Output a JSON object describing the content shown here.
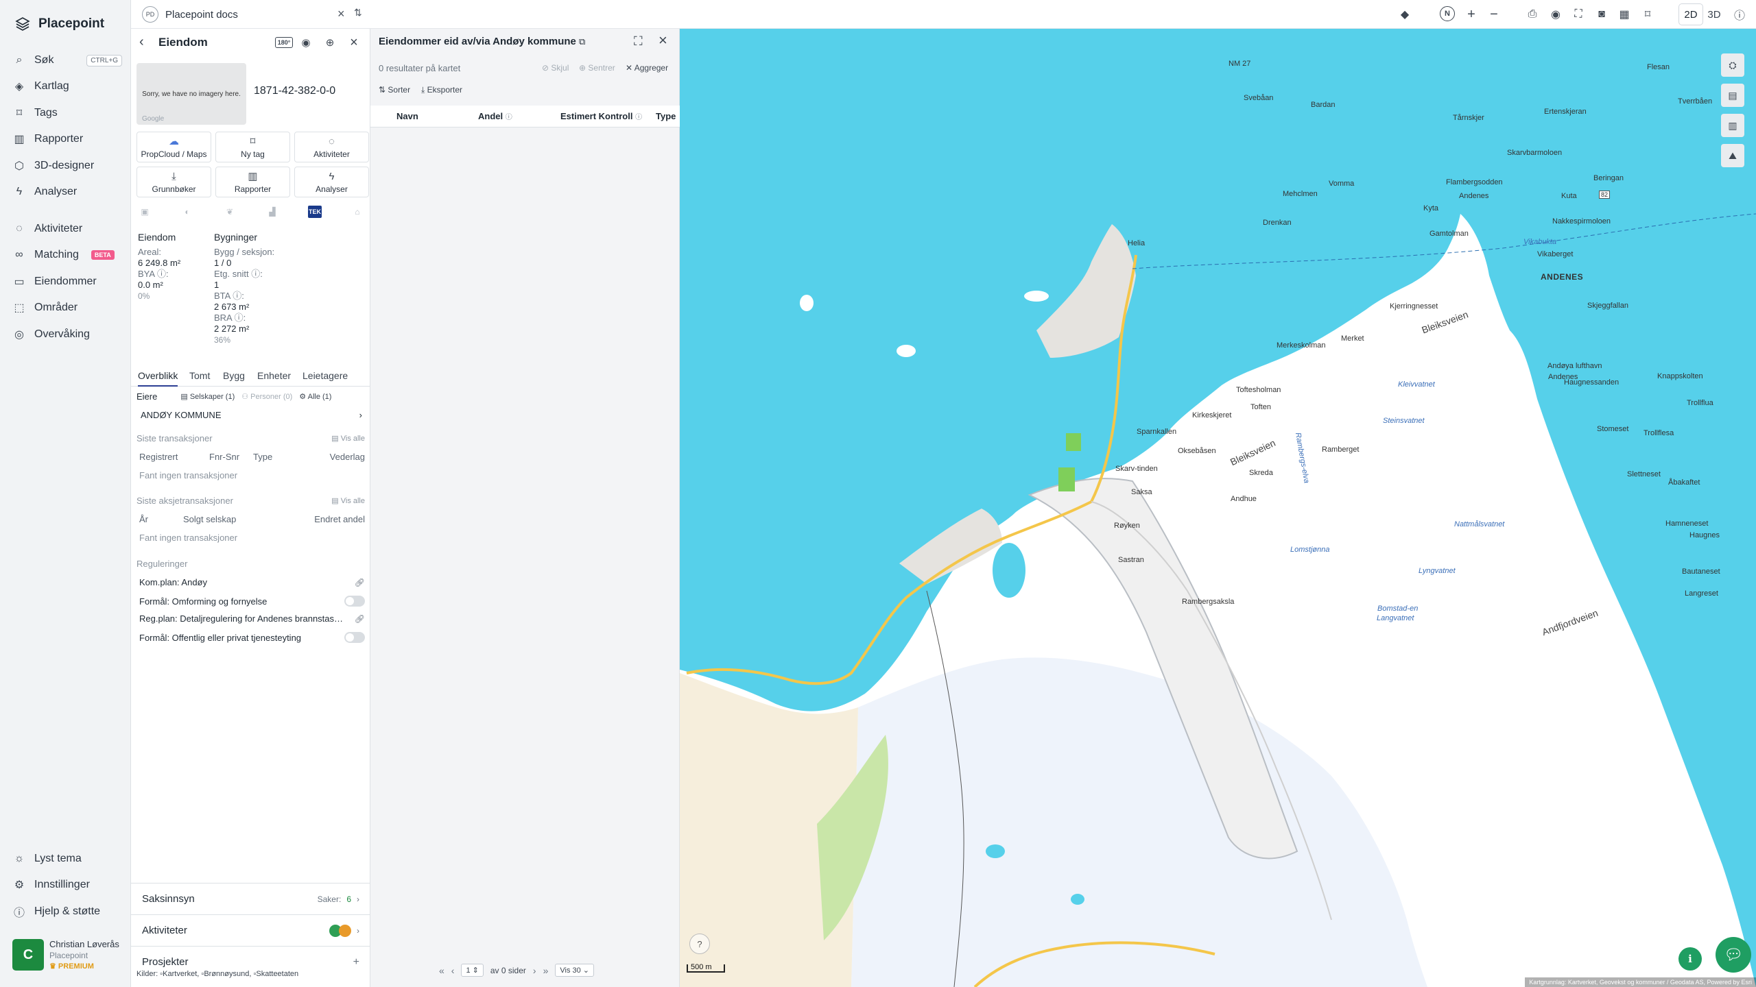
{
  "nav": {
    "brand": "Placepoint",
    "items": [
      {
        "label": "Søk",
        "kbd": "CTRL+G"
      },
      {
        "label": "Kartlag"
      },
      {
        "label": "Tags"
      },
      {
        "label": "Rapporter"
      },
      {
        "label": "3D-designer"
      },
      {
        "label": "Analyser"
      },
      {
        "label": "Aktiviteter"
      },
      {
        "label": "Matching",
        "badge": "BETA"
      },
      {
        "label": "Eiendommer"
      },
      {
        "label": "Områder"
      },
      {
        "label": "Overvåking"
      }
    ],
    "bottom": [
      {
        "label": "Lyst tema"
      },
      {
        "label": "Innstillinger"
      },
      {
        "label": "Hjelp & støtte"
      }
    ],
    "user": {
      "initial": "C",
      "name": "Christian Løverås",
      "org": "Placepoint",
      "plan": "PREMIUM"
    }
  },
  "topbar": {
    "doc_badge": "PD",
    "doc_title": "Placepoint docs",
    "mode_2d": "2D",
    "mode_3d": "3D",
    "north": "N"
  },
  "property": {
    "title": "Eiendom",
    "badge": "180°",
    "imagery_text": "Sorry, we have no imagery here.",
    "imagery_brand": "Google",
    "id": "1871-42-382-0-0",
    "actions": [
      {
        "label": "PropCloud / Maps"
      },
      {
        "label": "Ny tag"
      },
      {
        "label": "Aktiviteter"
      },
      {
        "label": "Grunnbøker"
      },
      {
        "label": "Rapporter"
      },
      {
        "label": "Analyser"
      }
    ],
    "source_tek": "TEK",
    "facts": {
      "eiendom_head": "Eiendom",
      "areal_label": "Areal:",
      "areal_value": "6 249.8 m²",
      "bya_label": "BYA ⓘ:",
      "bya_value": "0.0 m²",
      "bya_pct": "0%",
      "bygninger_head": "Bygninger",
      "bygg_label": "Bygg / seksjon:",
      "bygg_value": "1 / 0",
      "etg_label": "Etg. snitt ⓘ:",
      "etg_value": "1",
      "bta_label": "BTA ⓘ:",
      "bta_value": "2 673 m²",
      "bra_label": "BRA ⓘ:",
      "bra_value": "2 272 m²",
      "bra_pct": "36%"
    },
    "tabs": [
      "Overblikk",
      "Tomt",
      "Bygg",
      "Enheter",
      "Leietagere"
    ],
    "owners": {
      "label": "Eiere",
      "selskaper": "Selskaper (1)",
      "personer": "Personer (0)",
      "alle": "Alle (1)",
      "owner_name": "ANDØY KOMMUNE"
    },
    "transactions": {
      "title": "Siste transaksjoner",
      "vis_alle": "Vis alle",
      "cols": [
        "Registrert",
        "Fnr-Snr",
        "Type",
        "Vederlag"
      ],
      "empty": "Fant ingen transaksjoner"
    },
    "share_transactions": {
      "title": "Siste aksjetransaksjoner",
      "vis_alle": "Vis alle",
      "cols": [
        "År",
        "Solgt selskap",
        "Endret andel"
      ],
      "empty": "Fant ingen transaksjoner"
    },
    "regulations": {
      "title": "Reguleringer",
      "items": [
        "Kom.plan: Andøy",
        "Formål: Omforming og fornyelse",
        "Reg.plan: Detaljregulering for Andenes brannstas…",
        "Formål: Offentlig eller privat tjenesteyting"
      ]
    },
    "saksinnsyn": {
      "label": "Saksinnsyn",
      "count_label": "Saker:",
      "count": "6"
    },
    "aktiviteter": {
      "label": "Aktiviteter"
    },
    "prosjekter": {
      "label": "Prosjekter",
      "add": "+"
    },
    "sources_label": "Kilder:",
    "sources": [
      "Kartverket,",
      "Brønnøysund,",
      "Skatteetaten"
    ]
  },
  "results": {
    "title": "Eiendommer eid av/via Andøy kommune",
    "count": "0 resultater på kartet",
    "hide": "Skjul",
    "center": "Sentrer",
    "aggregate": "Aggreger",
    "sort": "Sorter",
    "export": "Eksporter",
    "columns": [
      "Navn",
      "Andel",
      "Estimert Kontroll",
      "Type"
    ],
    "pager": {
      "page": "1",
      "of": "av 0 sider",
      "per_page": "Vis 30"
    }
  },
  "map": {
    "labels": {
      "places": [
        "NM 27",
        "Flesan",
        "Svebåan",
        "Bardan",
        "Tverrbåen",
        "Tårnskjer",
        "Ertenskjeran",
        "Skarvbarmoloen",
        "Vomma",
        "Flambergsodden",
        "Beringan",
        "Mehclmen",
        "Andenes",
        "Kuta",
        "Kyta",
        "Drenkan",
        "Gamtolman",
        "Nakkespirmoloen",
        "Helia",
        "Vikaberget",
        "Skjeggfallan",
        "Kjerringnesset",
        "Merkeskolman",
        "Merket",
        "Andøya lufthavn",
        "Andenes",
        "Knappskolten",
        "Toftesholman",
        "Haugnessanden",
        "Trollflua",
        "Kirkeskjeret",
        "Toften",
        "Stomeset",
        "Sparnkallen",
        "Trollflesa",
        "Oksebåsen",
        "Ramberget",
        "Skarv-tinden",
        "Skreda",
        "Slettneset",
        "Saksa",
        "Andhue",
        "Åbakaftet",
        "Røyken",
        "Hamneneset",
        "Haugnes",
        "Sastran",
        "Bautaneset",
        "Rambergsaksla",
        "Langreset"
      ],
      "town": "ANDENES",
      "water": [
        "Vikabukta",
        "Kleivvatnet",
        "Steinsvatnet",
        "Nattmålsvatnet",
        "Lomstjønna",
        "Lyngvatnet",
        "Langvatnet",
        "Rambergs-elva",
        "Bomstad-en"
      ],
      "roads": [
        "Bleiksveien",
        "Bleiksveien",
        "Andfjordveien"
      ],
      "nm": "82"
    },
    "scale": "500 m",
    "attribution": "Kartgrunnlag: Kartverket, Geovekst og kommuner / Geodata AS, Powered by Esri"
  },
  "colors": {
    "sea": "#56d0ea",
    "land": "#ffffff",
    "accent": "#1f9e62",
    "active_tab": "#2c3e94"
  }
}
